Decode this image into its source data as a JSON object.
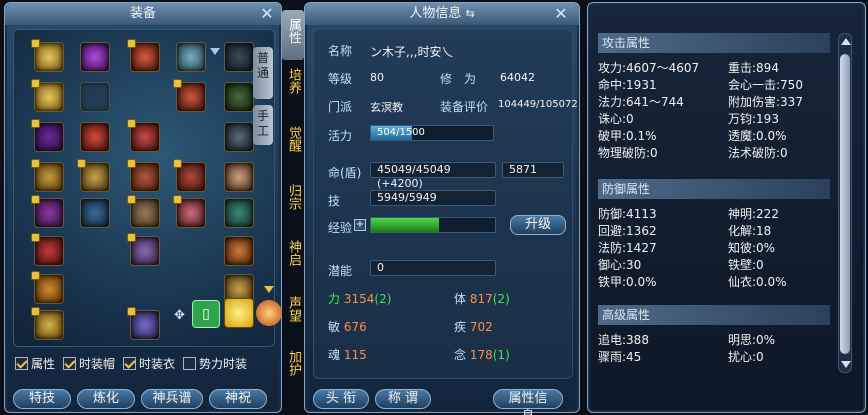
{
  "equipment": {
    "title": "装备",
    "side_tabs": [
      "普通",
      "手工"
    ],
    "checkboxes": [
      {
        "label": "属性",
        "checked": true
      },
      {
        "label": "时装帽",
        "checked": true
      },
      {
        "label": "时装衣",
        "checked": true
      },
      {
        "label": "势力时装",
        "checked": false
      }
    ],
    "buttons": [
      "特技",
      "炼化",
      "神兵谱",
      "神祝"
    ]
  },
  "vertical_tabs": [
    "属性",
    "培养",
    "觉醒",
    "归宗",
    "神启",
    "声望",
    "加护"
  ],
  "character": {
    "title": "人物信息",
    "name_label": "名称",
    "name": "ン木子,,,时安乀",
    "level_label": "等级",
    "level": "80",
    "cultivation_label": "修　为",
    "cultivation": "64042",
    "sect_label": "门派",
    "sect": "玄溟教",
    "gear_score_label": "装备评价",
    "gear_score": "104449/105072",
    "vigor_label": "活力",
    "vigor": "504/1500",
    "vigor_fraction": 0.336,
    "hp_label": "命(盾)",
    "hp": "45049/45049 (+4200)",
    "shield": "5871",
    "skill_label": "技",
    "skill": "5949/5949",
    "exp_label": "经验",
    "exp_fraction": 0.55,
    "upgrade_button": "升级",
    "potential_label": "潜能",
    "potential": "0",
    "stats": {
      "str": {
        "label": "力",
        "value": "3154",
        "bonus": "(2)"
      },
      "con": {
        "label": "体",
        "value": "817",
        "bonus": "(2)"
      },
      "agi": {
        "label": "敏",
        "value": "676",
        "bonus": ""
      },
      "spd": {
        "label": "疾",
        "value": "702",
        "bonus": ""
      },
      "soul": {
        "label": "魂",
        "value": "115",
        "bonus": ""
      },
      "mind": {
        "label": "念",
        "value": "178",
        "bonus": "(1)"
      }
    },
    "buttons": [
      "头 衔",
      "称 谓",
      "属性信息"
    ]
  },
  "attributes": {
    "attack": {
      "title": "攻击属性",
      "rows": [
        [
          "攻力:4607～4607",
          "重击:894"
        ],
        [
          "命中:1931",
          "会心一击:750"
        ],
        [
          "法力:641～744",
          "附加伤害:337"
        ],
        [
          "诛心:0",
          "万钧:193"
        ],
        [
          "破甲:0.1%",
          "透魔:0.0%"
        ],
        [
          "物理破防:0",
          "法术破防:0"
        ]
      ]
    },
    "defense": {
      "title": "防御属性",
      "rows": [
        [
          "防御:4113",
          "神明:222"
        ],
        [
          "回避:1362",
          "化解:18"
        ],
        [
          "法防:1427",
          "知彼:0%"
        ],
        [
          "御心:30",
          "铁壁:0"
        ],
        [
          "铁甲:0.0%",
          "仙衣:0.0%"
        ]
      ]
    },
    "advanced": {
      "title": "高级属性",
      "rows": [
        [
          "追电:388",
          "明思:0%"
        ],
        [
          "骤雨:45",
          "扰心:0"
        ]
      ]
    }
  }
}
